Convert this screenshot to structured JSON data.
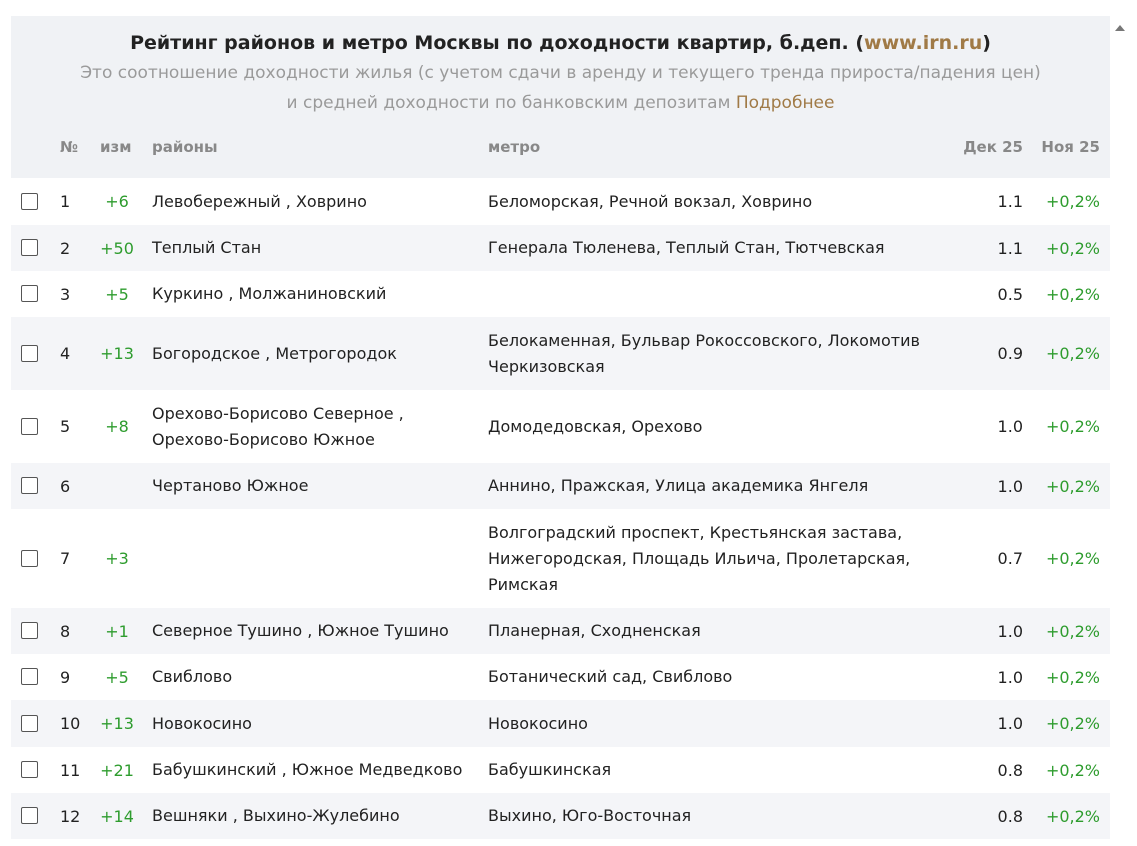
{
  "header": {
    "title_main": "Рейтинг районов и метро Москвы по доходности квартир, б.деп. (",
    "title_link": "www.irn.ru",
    "title_end": ")",
    "subtitle_line1": "Это соотношение доходности жилья (с учетом сдачи в аренду и текущего тренда прироста/падения цен)",
    "subtitle_line2": "и средней доходности по банковским депозитам",
    "more_link": "Подробнее"
  },
  "columns": {
    "num": "№",
    "change": "изм",
    "districts": "районы",
    "metro": "метро",
    "dec": "Дек 25",
    "nov": "Ноя 25"
  },
  "rows": [
    {
      "num": "1",
      "change": "+6",
      "districts": "Левобережный , Ховрино",
      "metro": "Беломорская, Речной вокзал, Ховрино",
      "dec": "1.1",
      "nov": "+0,2%"
    },
    {
      "num": "2",
      "change": "+50",
      "districts": "Теплый Стан",
      "metro": "Генерала Тюленева, Теплый Стан, Тютчевская",
      "dec": "1.1",
      "nov": "+0,2%"
    },
    {
      "num": "3",
      "change": "+5",
      "districts": "Куркино , Молжаниновский",
      "metro": "",
      "dec": "0.5",
      "nov": "+0,2%"
    },
    {
      "num": "4",
      "change": "+13",
      "districts": "Богородское , Метрогородок",
      "metro": "Белокаменная, Бульвар Рокоссовского, Локомотив Черкизовская",
      "dec": "0.9",
      "nov": "+0,2%"
    },
    {
      "num": "5",
      "change": "+8",
      "districts": "Орехово-Борисово Северное , Орехово-Борисово Южное",
      "metro": "Домодедовская, Орехово",
      "dec": "1.0",
      "nov": "+0,2%"
    },
    {
      "num": "6",
      "change": "",
      "districts": "Чертаново Южное",
      "metro": "Аннино, Пражская, Улица академика Янгеля",
      "dec": "1.0",
      "nov": "+0,2%"
    },
    {
      "num": "7",
      "change": "+3",
      "districts": "",
      "metro": "Волгоградский проспект, Крестьянская застава, Нижегородская, Площадь Ильича, Пролетарская, Римская",
      "dec": "0.7",
      "nov": "+0,2%"
    },
    {
      "num": "8",
      "change": "+1",
      "districts": "Северное Тушино , Южное Тушино",
      "metro": "Планерная, Сходненская",
      "dec": "1.0",
      "nov": "+0,2%"
    },
    {
      "num": "9",
      "change": "+5",
      "districts": "Свиблово",
      "metro": "Ботанический сад, Свиблово",
      "dec": "1.0",
      "nov": "+0,2%"
    },
    {
      "num": "10",
      "change": "+13",
      "districts": "Новокосино",
      "metro": "Новокосино",
      "dec": "1.0",
      "nov": "+0,2%"
    },
    {
      "num": "11",
      "change": "+21",
      "districts": "Бабушкинский , Южное Медведково",
      "metro": "Бабушкинская",
      "dec": "0.8",
      "nov": "+0,2%"
    },
    {
      "num": "12",
      "change": "+14",
      "districts": "Вешняки , Выхино-Жулебино",
      "metro": "Выхино, Юго-Восточная",
      "dec": "0.8",
      "nov": "+0,2%"
    }
  ]
}
